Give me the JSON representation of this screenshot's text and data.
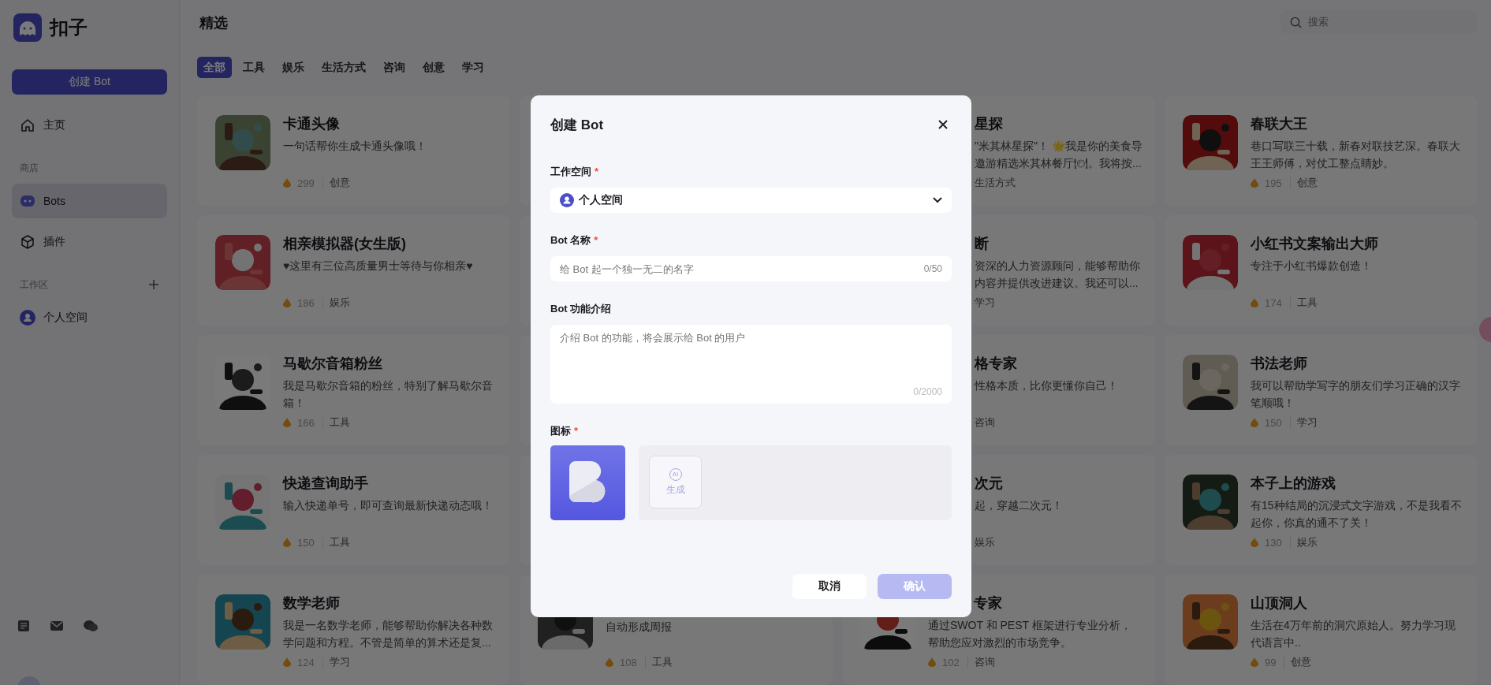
{
  "sidebar": {
    "brand": "扣子",
    "create_button": "创建 Bot",
    "nav": [
      {
        "label": "主页",
        "selected": false
      }
    ],
    "sections": [
      {
        "label": "商店",
        "addable": false,
        "items": [
          {
            "label": "Bots",
            "selected": true
          },
          {
            "label": "插件",
            "selected": false
          }
        ]
      },
      {
        "label": "工作区",
        "addable": true,
        "items": [
          {
            "label": "个人空间",
            "selected": false
          }
        ]
      }
    ]
  },
  "header": {
    "title": "精选",
    "search": {
      "placeholder": "搜索"
    }
  },
  "tabs": [
    {
      "label": "全部",
      "selected": true
    },
    {
      "label": "工具",
      "selected": false
    },
    {
      "label": "娱乐",
      "selected": false
    },
    {
      "label": "生活方式",
      "selected": false
    },
    {
      "label": "咨询",
      "selected": false
    },
    {
      "label": "创意",
      "selected": false
    },
    {
      "label": "学习",
      "selected": false
    }
  ],
  "cards": [
    {
      "kind": "bot",
      "title": "卡通头像",
      "desc": "一句话帮你生成卡通头像哦！",
      "count": "299",
      "tag": "创意"
    },
    {
      "kind": "hidden"
    },
    {
      "kind": "covered",
      "title": "星探",
      "desc_lines": [
        "\"米其林星探\"！ 🌟我是你的美食导",
        "邀游精选米其林餐厅🍽。我将按..."
      ],
      "tag": "生活方式"
    },
    {
      "kind": "bot",
      "title": "春联大王",
      "desc": "巷口写联三十载，新春对联技艺深。春联大王王师傅，对仗工整点睛妙。",
      "count": "195",
      "tag": "创意"
    },
    {
      "kind": "bot",
      "title": "相亲模拟器(女生版)",
      "desc": "♥这里有三位高质量男士等待与你相亲♥",
      "count": "186",
      "tag": "娱乐"
    },
    {
      "kind": "hidden"
    },
    {
      "kind": "covered",
      "title": "断",
      "desc_lines": [
        "资深的人力资源顾问，能够帮助你",
        "内容并提供改进建议。我还可以..."
      ],
      "tag": "学习"
    },
    {
      "kind": "bot",
      "title": "小红书文案输出大师",
      "desc": "专注于小红书爆款创造！",
      "count": "174",
      "tag": "工具"
    },
    {
      "kind": "bot",
      "title": "马歇尔音箱粉丝",
      "desc": "我是马歇尔音箱的粉丝，特别了解马歇尔音箱！",
      "count": "166",
      "tag": "工具"
    },
    {
      "kind": "hidden"
    },
    {
      "kind": "covered",
      "title": "格专家",
      "desc_lines": [
        "性格本质，比你更懂你自己！"
      ],
      "tag": "咨询"
    },
    {
      "kind": "bot",
      "title": "书法老师",
      "desc": "我可以帮助学写字的朋友们学习正确的汉字笔顺哦！",
      "count": "150",
      "tag": "学习"
    },
    {
      "kind": "bot",
      "title": "快递查询助手",
      "desc": "输入快递单号，即可查询最新快递动态哦！",
      "count": "150",
      "tag": "工具"
    },
    {
      "kind": "hidden"
    },
    {
      "kind": "covered",
      "title": "次元",
      "desc_lines": [
        "起，穿越二次元！"
      ],
      "tag": "娱乐"
    },
    {
      "kind": "bot",
      "title": "本子上的游戏",
      "desc": "有15种结局的沉浸式文字游戏，不是我看不起你，你真的通不了关！",
      "count": "130",
      "tag": "娱乐"
    },
    {
      "kind": "bot",
      "title": "数学老师",
      "desc": "我是一名数学老师，能够帮助你解决各种数学问题和方程。不管是简单的算术还是复...",
      "count": "124",
      "tag": "学习"
    },
    {
      "kind": "under",
      "desc": "自动形成周报",
      "count": "108",
      "tag": "工具"
    },
    {
      "kind": "under",
      "title": "专家",
      "desc": "通过SWOT 和 PEST 框架进行专业分析，帮助您应对激烈的市场竞争。",
      "count": "102",
      "tag": "咨询"
    },
    {
      "kind": "bot",
      "title": "山顶洞人",
      "desc": "生活在4万年前的洞穴原始人。努力学习现代语言中..",
      "count": "99",
      "tag": "创意"
    }
  ],
  "dialog": {
    "title": "创建 Bot",
    "workspace": {
      "label": "工作空间",
      "mark": "*",
      "value": "个人空间"
    },
    "name": {
      "label": "Bot 名称",
      "mark": "*",
      "placeholder": "给 Bot 起一个独一无二的名字",
      "counter": "0/50"
    },
    "intro": {
      "label": "Bot 功能介绍",
      "placeholder": "介绍 Bot 的功能，将会展示给 Bot 的用户",
      "counter": "0/2000"
    },
    "icon": {
      "label": "图标",
      "mark": "*",
      "generate": {
        "badge": "AI",
        "label": "生成"
      }
    },
    "buttons": [
      {
        "label": "取消",
        "kind": "secondary",
        "disabled": false
      },
      {
        "label": "确认",
        "kind": "primary",
        "disabled": true
      }
    ]
  }
}
